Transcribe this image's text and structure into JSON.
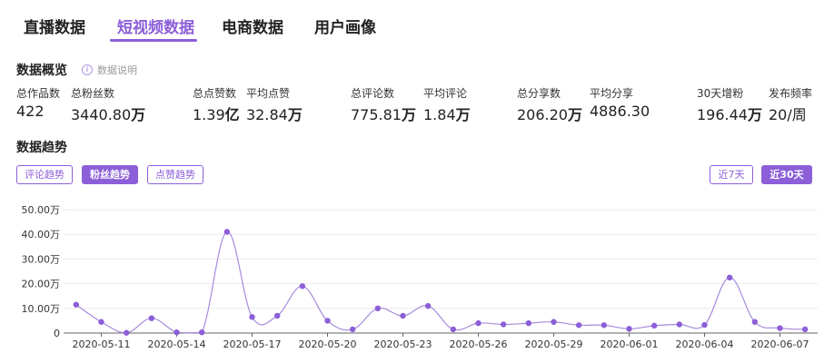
{
  "tabs": [
    {
      "label": "直播数据",
      "active": false
    },
    {
      "label": "短视频数据",
      "active": true
    },
    {
      "label": "电商数据",
      "active": false
    },
    {
      "label": "用户画像",
      "active": false
    }
  ],
  "overview": {
    "title": "数据概览",
    "info_text": "数据说明",
    "stats": [
      {
        "label": "总作品数",
        "value": "422",
        "unit": ""
      },
      {
        "label": "总粉丝数",
        "value": "3440.80",
        "unit": "万"
      },
      {
        "label": "总点赞数",
        "value": "1.39",
        "unit": "亿"
      },
      {
        "label": "平均点赞",
        "value": "32.84",
        "unit": "万"
      },
      {
        "label": "总评论数",
        "value": "775.81",
        "unit": "万"
      },
      {
        "label": "平均评论",
        "value": "1.84",
        "unit": "万"
      },
      {
        "label": "总分享数",
        "value": "206.20",
        "unit": "万"
      },
      {
        "label": "平均分享",
        "value": "4886.30",
        "unit": ""
      },
      {
        "label": "30天增粉",
        "value": "196.44",
        "unit": "万"
      },
      {
        "label": "发布频率",
        "value": "20/周",
        "unit": ""
      }
    ]
  },
  "trend": {
    "title": "数据趋势",
    "buttons": [
      {
        "label": "评论趋势",
        "active": false
      },
      {
        "label": "粉丝趋势",
        "active": true
      },
      {
        "label": "点赞趋势",
        "active": false
      }
    ],
    "ranges": [
      {
        "label": "近7天",
        "active": false
      },
      {
        "label": "近30天",
        "active": true
      }
    ]
  },
  "colors": {
    "accent": "#8c5fd8",
    "line": "#a78bdb",
    "point": "#8c5fd8",
    "grid": "#ececec"
  },
  "chart_data": {
    "type": "line",
    "x": [
      "2020-05-10",
      "2020-05-11",
      "2020-05-12",
      "2020-05-13",
      "2020-05-14",
      "2020-05-15",
      "2020-05-16",
      "2020-05-17",
      "2020-05-18",
      "2020-05-19",
      "2020-05-20",
      "2020-05-21",
      "2020-05-22",
      "2020-05-23",
      "2020-05-24",
      "2020-05-25",
      "2020-05-26",
      "2020-05-27",
      "2020-05-28",
      "2020-05-29",
      "2020-05-30",
      "2020-05-31",
      "2020-06-01",
      "2020-06-02",
      "2020-06-03",
      "2020-06-04",
      "2020-06-05",
      "2020-06-06",
      "2020-06-07",
      "2020-06-08"
    ],
    "values": [
      11.5,
      4.5,
      0.1,
      6.0,
      0.3,
      0.3,
      41.0,
      6.5,
      7.0,
      19.0,
      5.0,
      1.5,
      10.0,
      7.0,
      11.0,
      1.5,
      4.0,
      3.5,
      4.0,
      4.5,
      3.2,
      3.2,
      1.7,
      3.0,
      3.5,
      3.3,
      22.5,
      4.5,
      2.0,
      1.5
    ],
    "x_tick_labels": [
      "2020-05-11",
      "2020-05-14",
      "2020-05-17",
      "2020-05-20",
      "2020-05-23",
      "2020-05-26",
      "2020-05-29",
      "2020-06-01",
      "2020-06-04",
      "2020-06-07"
    ],
    "y_ticks": [
      "0",
      "10.00万",
      "20.00万",
      "30.00万",
      "40.00万",
      "50.00万"
    ],
    "ylim": [
      0,
      50
    ],
    "grid": true
  }
}
